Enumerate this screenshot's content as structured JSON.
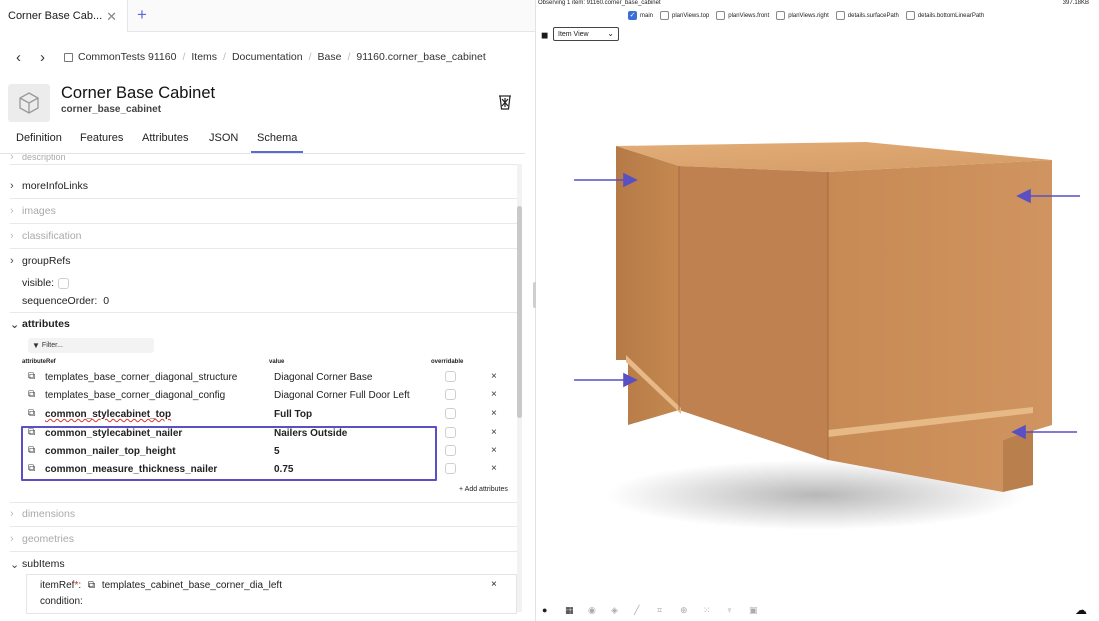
{
  "tabs": {
    "active_label": "Corner Base Cab...",
    "close_icon": "close-icon",
    "add_icon": "plus-icon"
  },
  "breadcrumb": {
    "items": [
      "CommonTests 91160",
      "Items",
      "Documentation",
      "Base",
      "91160.corner_base_cabinet"
    ]
  },
  "header": {
    "title": "Corner Base Cabinet",
    "subtitle": "corner_base_cabinet",
    "icon": "cube-icon",
    "trash_icon": "trash-icon"
  },
  "nav_tabs": [
    "Definition",
    "Features",
    "Attributes",
    "JSON",
    "Schema"
  ],
  "active_nav_tab": "Schema",
  "schema": {
    "sections": {
      "description": "description",
      "moreInfoLinks": "moreInfoLinks",
      "images": "images",
      "classification": "classification",
      "groupRefs": "groupRefs",
      "visible": "visible:",
      "sequenceOrder_label": "sequenceOrder:",
      "sequenceOrder_value": "0",
      "attributes": "attributes",
      "dimensions": "dimensions",
      "geometries": "geometries",
      "subItems": "subItems"
    },
    "filter_placeholder": "Filter...",
    "columns": {
      "ref": "attributeRef",
      "value": "value",
      "overridable": "overridable"
    },
    "attributes": [
      {
        "ref": "templates_base_corner_diagonal_structure",
        "value": "Diagonal Corner Base",
        "bold": false
      },
      {
        "ref": "templates_base_corner_diagonal_config",
        "value": "Diagonal Corner Full Door Left",
        "bold": false
      },
      {
        "ref": "common_stylecabinet_top",
        "value": "Full Top",
        "bold": true
      },
      {
        "ref": "common_stylecabinet_nailer",
        "value": "Nailers Outside",
        "bold": true
      },
      {
        "ref": "common_nailer_top_height",
        "value": "5",
        "bold": true
      },
      {
        "ref": "common_measure_thickness_nailer",
        "value": "0.75",
        "bold": true
      }
    ],
    "add_attributes_label": "+ Add attributes",
    "remove_symbol": "×",
    "sub_item": {
      "ref_label": "itemRef",
      "required_mark": "*",
      "ref_value": "templates_cabinet_base_corner_dia_left",
      "condition_label": "condition:"
    }
  },
  "viewer": {
    "observing": "Observing 1 item: 91160.corner_base_cabinet",
    "size": "397.18KB",
    "layers": [
      {
        "label": "main",
        "checked": true
      },
      {
        "label": "planViews.top",
        "checked": false
      },
      {
        "label": "planViews.front",
        "checked": false
      },
      {
        "label": "planViews.right",
        "checked": false
      },
      {
        "label": "details.surfacePath",
        "checked": false
      },
      {
        "label": "details.bottomLinearPath",
        "checked": false
      }
    ],
    "view_select": "Item View",
    "arrow_color": "#5a4fc3",
    "wood_color": "#c98f5c",
    "tools": [
      "palette-icon",
      "grid-icon",
      "compass-icon",
      "cube-icon",
      "brush-icon",
      "crop-icon",
      "target-icon",
      "dots-icon",
      "hierarchy-icon",
      "image-icon"
    ],
    "cloud_icon": "cloud-download-icon"
  }
}
